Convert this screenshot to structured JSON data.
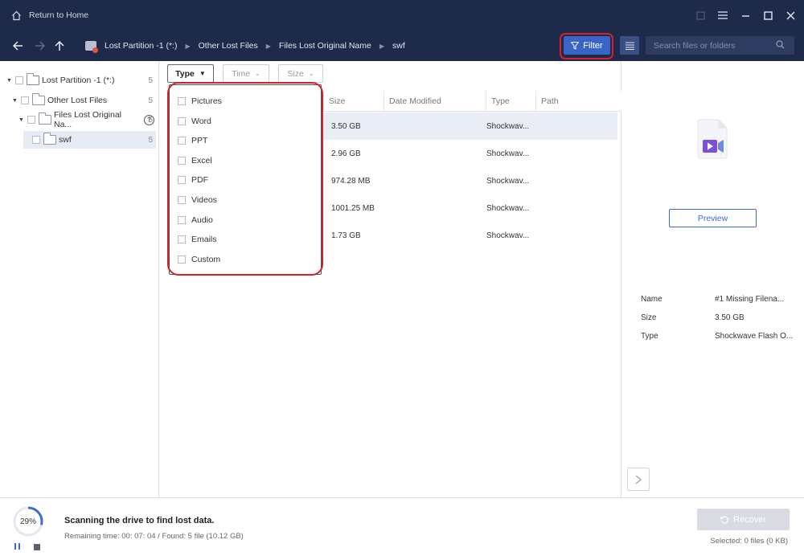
{
  "titlebar": {
    "home_label": "Return to Home"
  },
  "navbar": {
    "breadcrumbs": [
      "Lost Partition -1 (*:)",
      "Other Lost Files",
      "Files Lost Original Name",
      "swf"
    ],
    "filter_label": "Filter",
    "search_placeholder": "Search files or folders"
  },
  "tree": {
    "items": [
      {
        "label": "Lost Partition -1 (*:)",
        "count": "5"
      },
      {
        "label": "Other Lost Files",
        "count": "5"
      },
      {
        "label": "Files Lost Original Na...",
        "count": "5",
        "help": "?"
      },
      {
        "label": "swf",
        "count": "5"
      }
    ]
  },
  "filters": {
    "type_label": "Type",
    "time_label": "Time",
    "size_label": "Size"
  },
  "columns": {
    "size": "Size",
    "date_modified": "Date Modified",
    "type": "Type",
    "path": "Path"
  },
  "files": [
    {
      "size": "3.50 GB",
      "type": "Shockwav..."
    },
    {
      "size": "2.96 GB",
      "type": "Shockwav..."
    },
    {
      "size": "974.28 MB",
      "type": "Shockwav..."
    },
    {
      "size": "1001.25 MB",
      "type": "Shockwav..."
    },
    {
      "size": "1.73 GB",
      "type": "Shockwav..."
    }
  ],
  "type_dropdown": {
    "options": [
      "Pictures",
      "Word",
      "PPT",
      "Excel",
      "PDF",
      "Videos",
      "Audio",
      "Emails",
      "Custom"
    ]
  },
  "preview": {
    "button_label": "Preview",
    "props": [
      {
        "key": "Name",
        "value": "#1 Missing Filena..."
      },
      {
        "key": "Size",
        "value": "3.50 GB"
      },
      {
        "key": "Type",
        "value": "Shockwave Flash O..."
      }
    ]
  },
  "status": {
    "progress_text": "29%",
    "progress_value": 29,
    "title": "Scanning the drive to find lost data.",
    "subtitle": "Remaining time: 00: 07: 04 / Found: 5 file (10.12 GB)",
    "recover_label": "Recover",
    "selected_info": "Selected: 0 files (0 KB)"
  },
  "colors": {
    "titlebar_bg": "#1e2a4a",
    "accent": "#3a64c8",
    "highlight": "#d6202a"
  }
}
